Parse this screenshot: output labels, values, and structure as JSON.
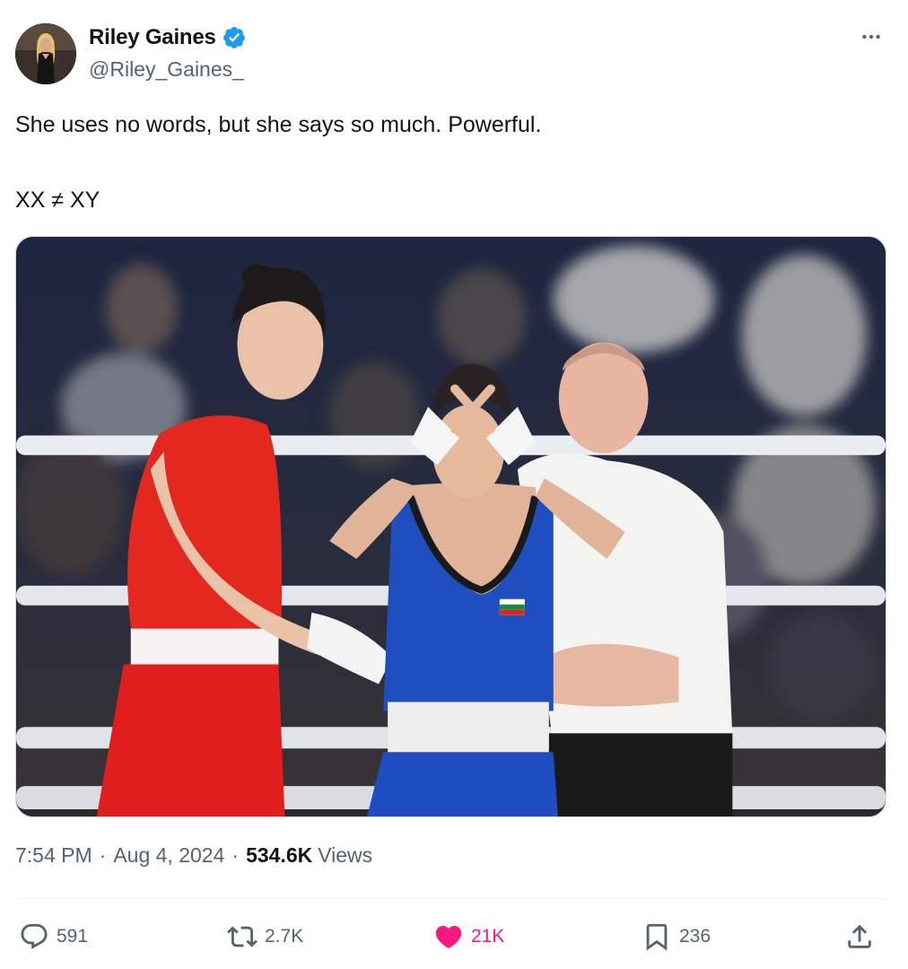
{
  "author": {
    "name": "Riley Gaines",
    "handle": "@Riley_Gaines_",
    "verified_icon": "verified-badge-icon",
    "verified_color": "#1d9bf0"
  },
  "tweet": {
    "line1": "She uses no words, but she says so much. Powerful.",
    "line2": "XX ≠ XY"
  },
  "meta": {
    "time": "7:54 PM",
    "date": "Aug 4, 2024",
    "separator": "·",
    "views_count": "534.6K",
    "views_label": "Views"
  },
  "actions": {
    "replies": "591",
    "reposts": "2.7K",
    "likes": "21K",
    "bookmarks": "236"
  },
  "colors": {
    "text_primary": "#0f1419",
    "text_secondary": "#536471",
    "like_active": "#f91880"
  }
}
